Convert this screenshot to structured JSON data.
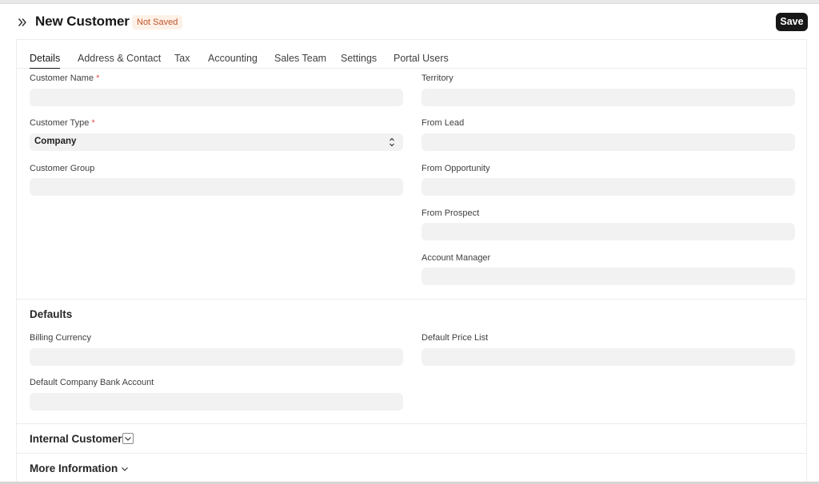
{
  "header": {
    "title": "New Customer",
    "status": "Not Saved",
    "save_label": "Save"
  },
  "tabs": [
    {
      "label": "Details",
      "active": true
    },
    {
      "label": "Address & Contact"
    },
    {
      "label": "Tax"
    },
    {
      "label": "Accounting"
    },
    {
      "label": "Sales Team"
    },
    {
      "label": "Settings"
    },
    {
      "label": "Portal Users"
    }
  ],
  "details": {
    "customer_name": {
      "label": "Customer Name",
      "value": "",
      "required_mark": "*"
    },
    "customer_type": {
      "label": "Customer Type",
      "value": "Company",
      "required_mark": "*"
    },
    "customer_group": {
      "label": "Customer Group",
      "value": ""
    },
    "territory": {
      "label": "Territory",
      "value": ""
    },
    "from_lead": {
      "label": "From Lead",
      "value": ""
    },
    "from_opportunity": {
      "label": "From Opportunity",
      "value": ""
    },
    "from_prospect": {
      "label": "From Prospect",
      "value": ""
    },
    "account_manager": {
      "label": "Account Manager",
      "value": ""
    }
  },
  "defaults": {
    "title": "Defaults",
    "billing_currency": {
      "label": "Billing Currency",
      "value": ""
    },
    "default_price_list": {
      "label": "Default Price List",
      "value": ""
    },
    "default_bank_account": {
      "label": "Default Company Bank Account",
      "value": ""
    }
  },
  "sections": {
    "internal_customer": "Internal Customer",
    "more_information": "More Information"
  },
  "colors": {
    "accent": "#171717",
    "badge_bg": "#fdf1e7",
    "badge_text": "#c2532a",
    "required": "#e24c4c",
    "field_bg": "#f2f2f2"
  },
  "icons": {
    "sidebar_toggle": "chevrons-right-icon",
    "select": "up-down-arrows-icon",
    "collapse": "chevron-down-icon"
  }
}
